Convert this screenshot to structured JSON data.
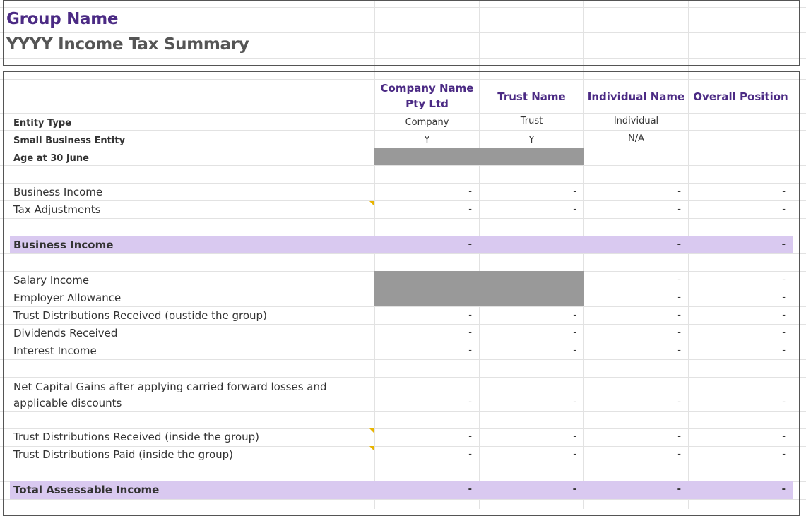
{
  "sheet": {
    "group_name": "Group Name",
    "summary_title": "YYYY Income Tax Summary"
  },
  "columns": [
    {
      "header": "Company Name Pty Ltd",
      "entity_type": "Company",
      "sbe": "Y"
    },
    {
      "header": "Trust Name",
      "entity_type": "Trust",
      "sbe": "Y"
    },
    {
      "header": "Individual Name",
      "entity_type": "Individual",
      "sbe": "N/A"
    },
    {
      "header": "Overall Position",
      "entity_type": "",
      "sbe": ""
    }
  ],
  "labels": {
    "entity_type": "Entity Type",
    "sbe": "Small Business Entity",
    "age": "Age at 30 June",
    "business_income": "Business Income",
    "tax_adjustments": "Tax Adjustments",
    "business_income_total": "Business Income",
    "salary_income": "Salary Income",
    "employer_allowance": "Employer Allowance",
    "trust_dist_outside": "Trust Distributions Received (oustide the group)",
    "dividends": "Dividends Received",
    "interest": "Interest Income",
    "net_cap_gains": "Net Capital Gains after applying carried forward losses and applicable discounts",
    "trust_dist_inside": "Trust Distributions Received (inside the group)",
    "trust_paid_inside": "Trust Distributions Paid (inside the group)",
    "total_assessable": "Total Assessable Income"
  },
  "dash": "-",
  "colors": {
    "accent": "#4b2a84",
    "band": "#d9c9f0",
    "disabled_cell": "#999999",
    "comment_marker": "#e8b400"
  }
}
